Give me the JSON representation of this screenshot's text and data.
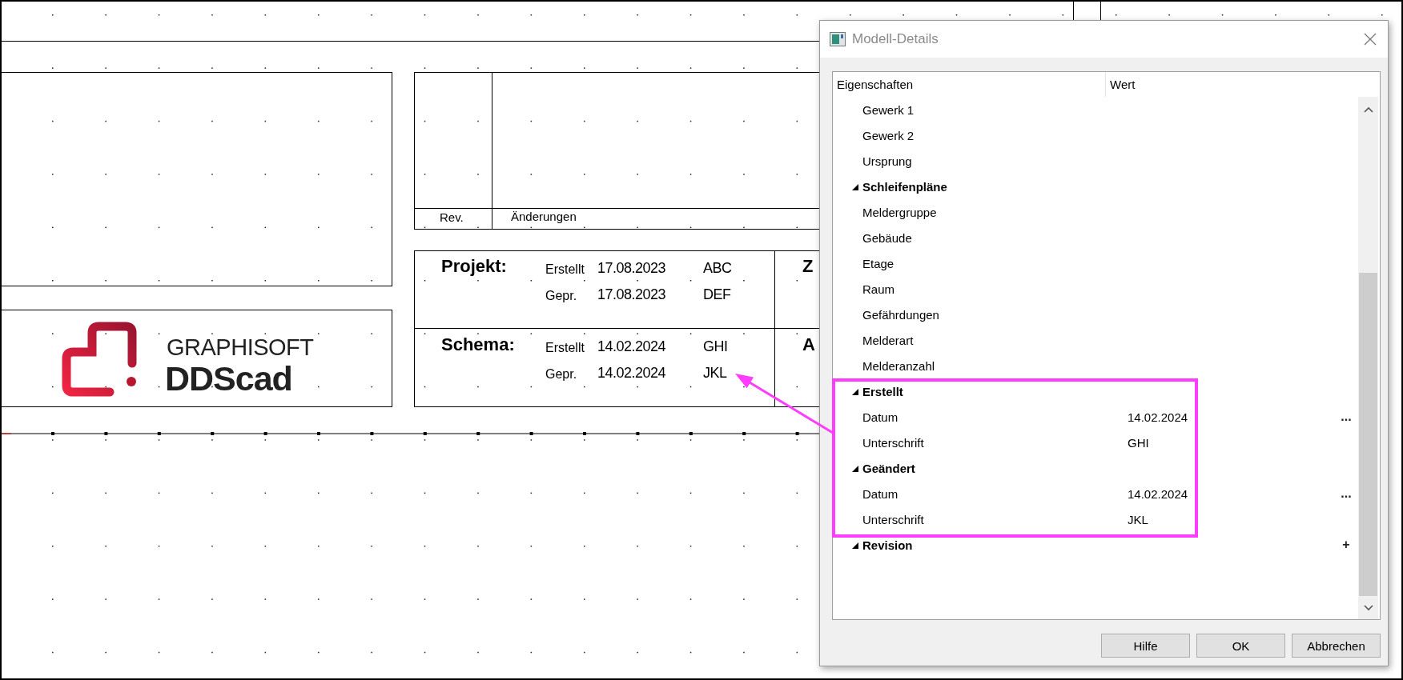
{
  "drawing": {
    "revision_table": {
      "columns": [
        "Rev.",
        "Änderungen"
      ]
    },
    "logo": {
      "line1": "GRAPHISOFT",
      "line2": "DDScad"
    },
    "title_block": {
      "rows": [
        {
          "label": "Projekt:",
          "entries": [
            {
              "kind": "Erstellt",
              "date": "17.08.2023",
              "initials": "ABC"
            },
            {
              "kind": "Gepr.",
              "date": "17.08.2023",
              "initials": "DEF"
            }
          ],
          "column_3": "Z"
        },
        {
          "label": "Schema:",
          "entries": [
            {
              "kind": "Erstellt",
              "date": "14.02.2024",
              "initials": "GHI"
            },
            {
              "kind": "Gepr.",
              "date": "14.02.2024",
              "initials": "JKL"
            }
          ],
          "column_3": "A"
        }
      ]
    }
  },
  "dialog": {
    "title": "Modell-Details",
    "columns": [
      "Eigenschaften",
      "Wert"
    ],
    "rows": [
      {
        "kind": "item",
        "label": "Gewerk 1"
      },
      {
        "kind": "item",
        "label": "Gewerk 2"
      },
      {
        "kind": "item",
        "label": "Ursprung"
      },
      {
        "kind": "group",
        "label": "Schleifenpläne",
        "expanded": true,
        "children": [
          {
            "kind": "item",
            "label": "Meldergruppe"
          },
          {
            "kind": "item",
            "label": "Gebäude"
          },
          {
            "kind": "item",
            "label": "Etage"
          },
          {
            "kind": "item",
            "label": "Raum"
          },
          {
            "kind": "item",
            "label": "Gefährdungen"
          },
          {
            "kind": "item",
            "label": "Melderart"
          },
          {
            "kind": "item",
            "label": "Melderanzahl"
          }
        ]
      },
      {
        "kind": "group",
        "label": "Erstellt",
        "expanded": true,
        "children": [
          {
            "kind": "item",
            "label": "Datum",
            "value": "14.02.2024",
            "action": "..."
          },
          {
            "kind": "item",
            "label": "Unterschrift",
            "value": "GHI"
          }
        ]
      },
      {
        "kind": "group",
        "label": "Geändert",
        "expanded": true,
        "children": [
          {
            "kind": "item",
            "label": "Datum",
            "value": "14.02.2024",
            "action": "..."
          },
          {
            "kind": "item",
            "label": "Unterschrift",
            "value": "JKL"
          }
        ]
      },
      {
        "kind": "group",
        "label": "Revision",
        "expanded": true,
        "action": "+"
      }
    ],
    "buttons": [
      "Hilfe",
      "OK",
      "Abbrechen"
    ]
  }
}
